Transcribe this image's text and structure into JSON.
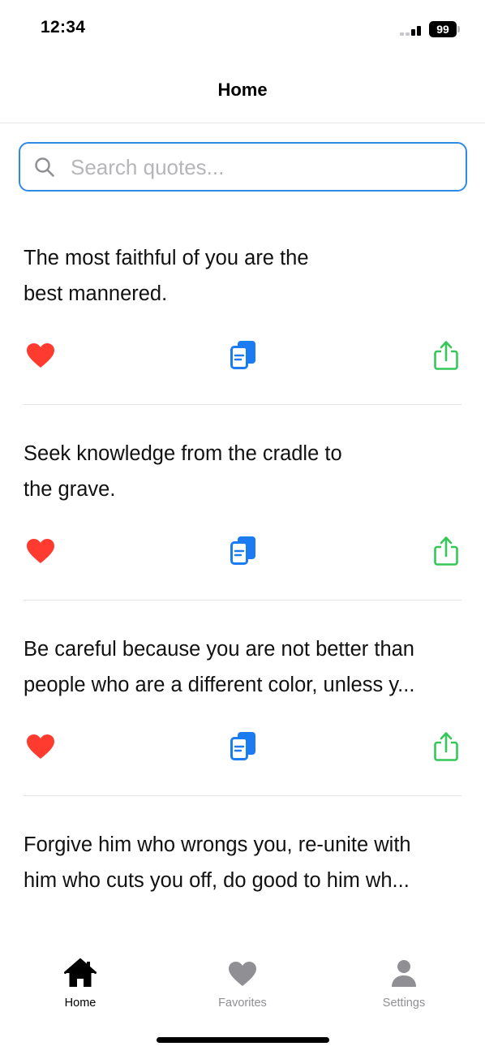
{
  "status_bar": {
    "time": "12:34",
    "battery": "99"
  },
  "nav": {
    "title": "Home"
  },
  "search": {
    "placeholder": "Search quotes...",
    "value": ""
  },
  "quotes": [
    {
      "line1": "The most faithful of you are the",
      "line2": "best mannered."
    },
    {
      "line1": "Seek knowledge from the cradle to",
      "line2": "the grave."
    },
    {
      "line1": "Be careful because you are not better than",
      "line2": "people who are a different color, unless y..."
    },
    {
      "line1": "Forgive him who wrongs you, re-unite with",
      "line2": "him who cuts you off, do good to him wh..."
    }
  ],
  "tabs": [
    {
      "label": "Home",
      "icon": "house-icon",
      "active": true
    },
    {
      "label": "Favorites",
      "icon": "heart-icon",
      "active": false
    },
    {
      "label": "Settings",
      "icon": "person-icon",
      "active": false
    }
  ],
  "colors": {
    "accent": "#2f8ae6",
    "favorite": "#ff3b30",
    "copy": "#1a7cf0",
    "share": "#34c759",
    "tab_inactive": "#8f8f94"
  }
}
